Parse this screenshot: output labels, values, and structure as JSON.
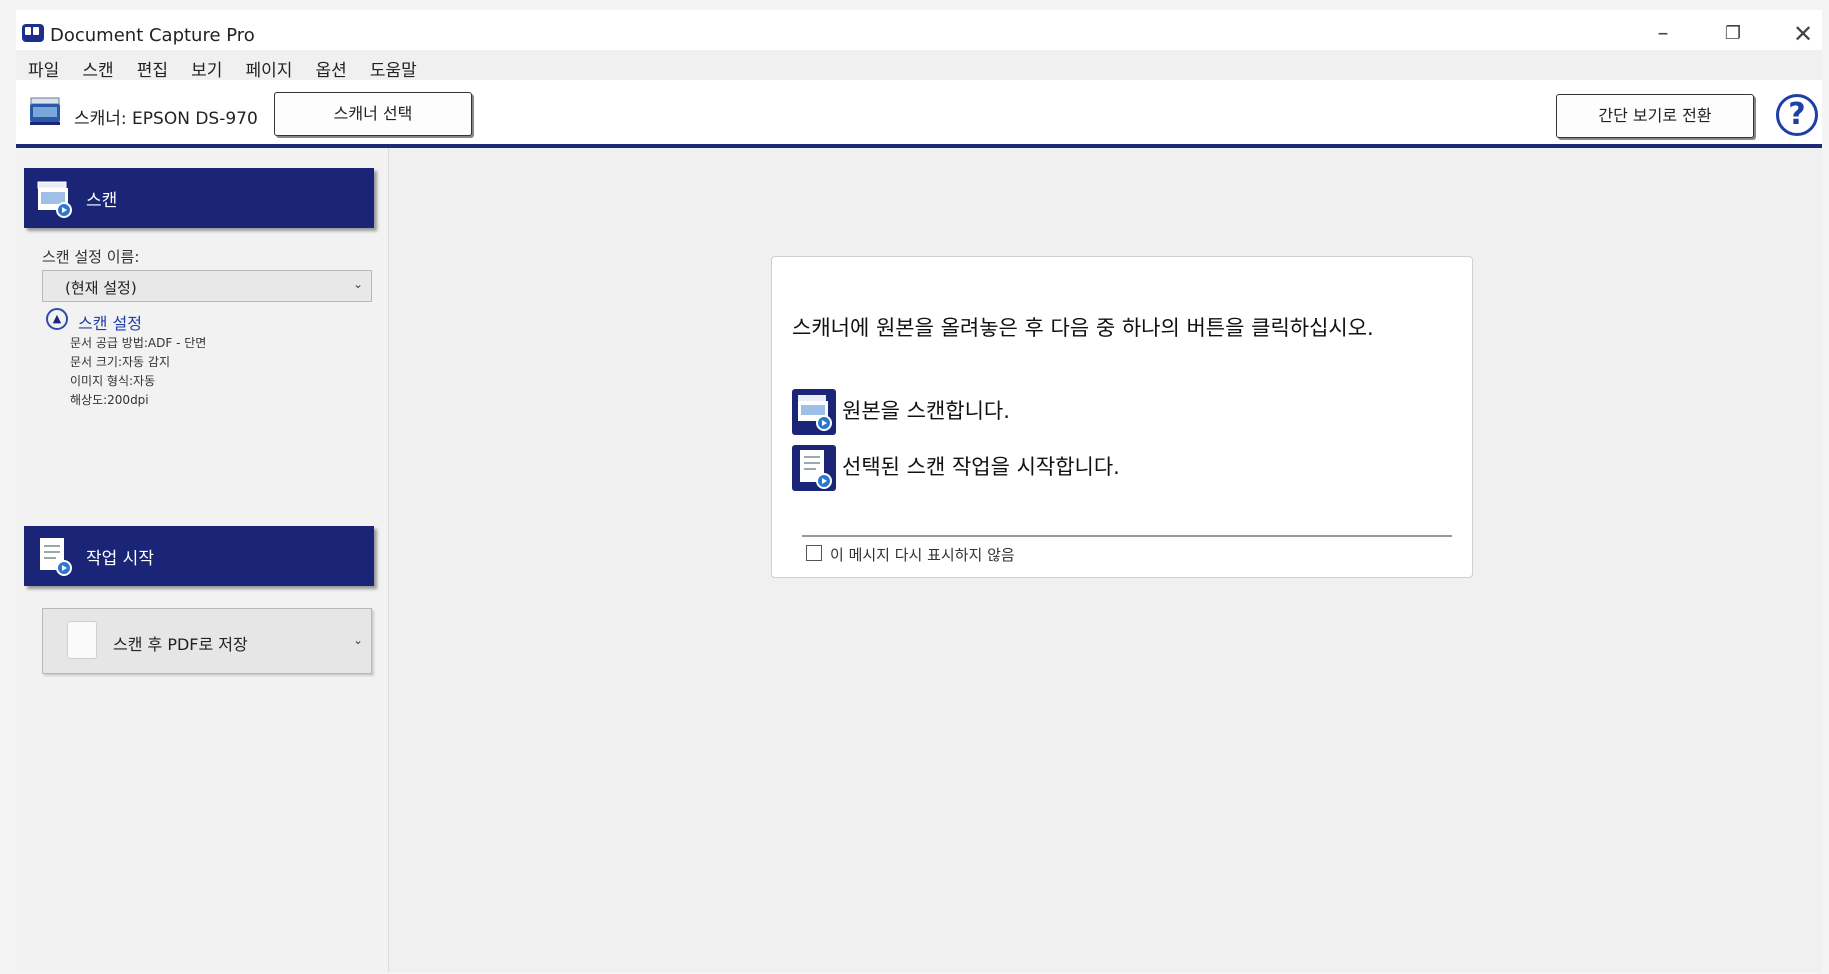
{
  "window": {
    "title": "Document Capture Pro",
    "minimize": "–",
    "restore": "❐",
    "close": "✕"
  },
  "menu": {
    "items": [
      "파일",
      "스캔",
      "편집",
      "보기",
      "페이지",
      "옵션",
      "도움말"
    ]
  },
  "toolbar": {
    "scanner_label": "스캐너: EPSON DS-970",
    "select_scanner_button": "스캐너 선택",
    "simple_view_button": "간단 보기로 전환",
    "help": "?"
  },
  "scan_section": {
    "header": "스캔",
    "setting_name_label": "스캔 설정 이름:",
    "setting_name_value": "(현재 설정)",
    "settings_title": "스캔 설정",
    "settings_details": [
      "문서 공급 방법:ADF - 단면",
      "문서 크기:자동 감지",
      "이미지 형식:자동",
      "해상도:200dpi"
    ]
  },
  "job_section": {
    "header": "작업 시작",
    "selected_job": "스캔 후 PDF로 저장"
  },
  "dialog": {
    "message": "스캐너에 원본을 올려놓은 후 다음 중 하나의 버튼을 클릭하십시오.",
    "action_scan": "원본을 스캔합니다.",
    "action_job": "선택된 스캔 작업을 시작합니다.",
    "checkbox_label": "이 메시지 다시 표시하지 않음",
    "checkbox_checked": false
  },
  "colors": {
    "accent": "#1a2578",
    "link": "#1d3fa8"
  },
  "icons": [
    "app-icon",
    "scanner-icon",
    "help-icon",
    "scan-icon",
    "job-start-icon",
    "document-icon",
    "chevron-down-icon"
  ]
}
